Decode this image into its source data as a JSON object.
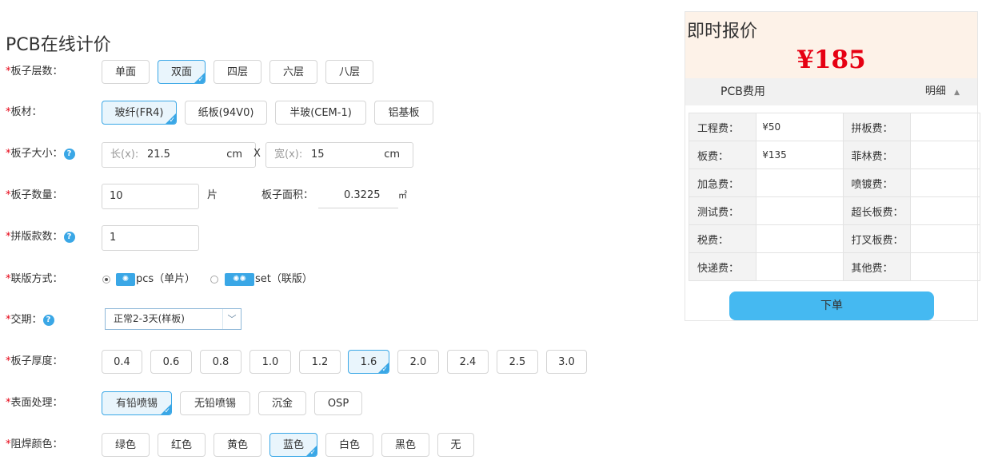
{
  "page_title": "PCB在线计价",
  "required_mark": "*",
  "help_glyph": "?",
  "layers": {
    "label": "板子层数：",
    "options": [
      "单面",
      "双面",
      "四层",
      "六层",
      "八层"
    ],
    "selected": "双面"
  },
  "material": {
    "label": "板材：",
    "options": [
      "玻纤(FR4)",
      "纸板(94V0)",
      "半玻(CEM-1)",
      "铝基板"
    ],
    "selected": "玻纤(FR4)"
  },
  "size": {
    "label": "板子大小：",
    "length_placeholder": "长(x):",
    "length_value": "21.5",
    "length_unit": "cm",
    "sep": "X",
    "width_placeholder": "宽(x):",
    "width_value": "15",
    "width_unit": "cm"
  },
  "quantity": {
    "label": "板子数量：",
    "value": "10",
    "unit": "片",
    "area_label": "板子面积：",
    "area_value": "0.3225",
    "area_unit": "㎡"
  },
  "panel_count": {
    "label": "拼版款数：",
    "value": "1"
  },
  "panel_mode": {
    "label": "联版方式：",
    "pcs_label": "pcs（单片）",
    "set_label": "set（联版）",
    "selected": "pcs"
  },
  "delivery": {
    "label": "交期：",
    "value": "正常2-3天(样板)"
  },
  "thickness": {
    "label": "板子厚度：",
    "options": [
      "0.4",
      "0.6",
      "0.8",
      "1.0",
      "1.2",
      "1.6",
      "2.0",
      "2.4",
      "2.5",
      "3.0"
    ],
    "selected": "1.6"
  },
  "surface": {
    "label": "表面处理：",
    "options": [
      "有铅喷锡",
      "无铅喷锡",
      "沉金",
      "OSP"
    ],
    "selected": "有铅喷锡"
  },
  "solder_color": {
    "label": "阻焊颜色：",
    "options": [
      "绿色",
      "红色",
      "黄色",
      "蓝色",
      "白色",
      "黑色",
      "无"
    ],
    "selected": "蓝色"
  },
  "quote": {
    "title": "即时报价",
    "price": "¥185",
    "fee_title": "PCB费用",
    "detail_label": "明细",
    "fees": [
      {
        "k1": "工程费：",
        "v1": "¥50",
        "k2": "拼板费：",
        "v2": ""
      },
      {
        "k1": "板费：",
        "v1": "¥135",
        "k2": "菲林费：",
        "v2": ""
      },
      {
        "k1": "加急费：",
        "v1": "",
        "k2": "喷镀费：",
        "v2": ""
      },
      {
        "k1": "测试费：",
        "v1": "",
        "k2": "超长板费：",
        "v2": ""
      },
      {
        "k1": "税费：",
        "v1": "",
        "k2": "打叉板费：",
        "v2": ""
      },
      {
        "k1": "快递费：",
        "v1": "",
        "k2": "其他费：",
        "v2": ""
      }
    ],
    "order_label": "下单"
  },
  "colors": {
    "accent": "#3aa7e6",
    "price": "#e60012",
    "order_button": "#45b9f1",
    "quote_bg": "#fdf2e8"
  }
}
